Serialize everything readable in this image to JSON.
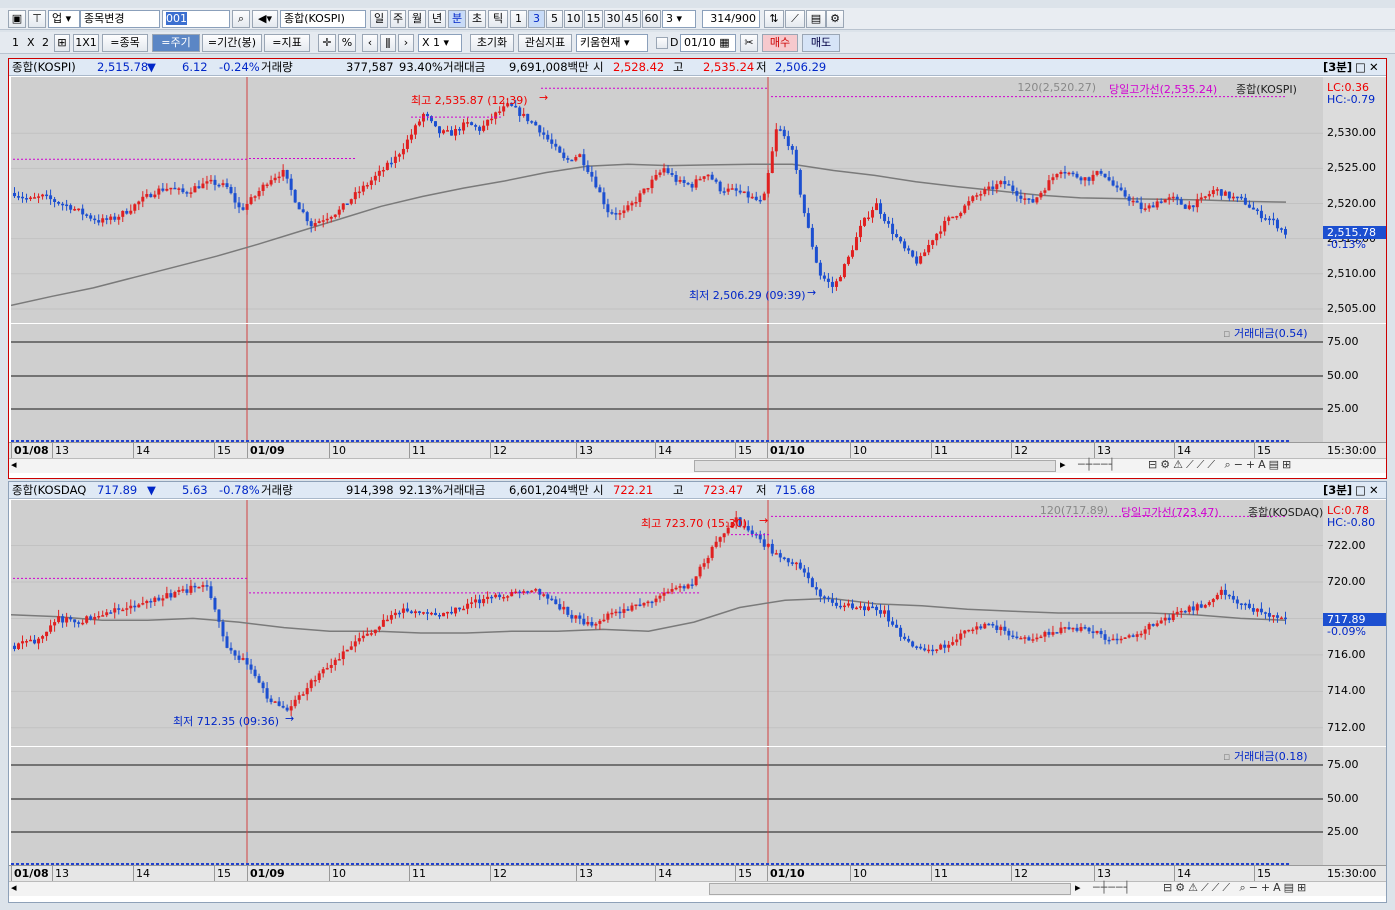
{
  "toolbar1": {
    "upjong": "업",
    "stock_change": "종목변경",
    "code": "001",
    "name": "종합(KOSPI)",
    "periods": [
      "일",
      "주",
      "월",
      "년",
      "분",
      "초",
      "틱"
    ],
    "selected_period": "분",
    "minutes": [
      "1",
      "3",
      "5",
      "10",
      "15",
      "30",
      "45",
      "60"
    ],
    "selected_minute": "3",
    "minute_select": "3",
    "count": "314",
    "count_total": "/900"
  },
  "toolbar2": {
    "layout": [
      "1",
      "X",
      "2"
    ],
    "grid_label": "1X1",
    "stock_btn": "=종목",
    "period_btn": "=주기",
    "range_btn": "=기간(봉)",
    "indicator_btn": "=지표",
    "pct": "%",
    "zoom": "X 1",
    "reset": "초기화",
    "interest": "관심지표",
    "kiwoom": "키움현재",
    "d_label": "D",
    "date": "01/10",
    "buy": "매수",
    "sell": "매도"
  },
  "pane1": {
    "name": "종합(KOSPI)",
    "price": "2,515.78",
    "arrow": "▼",
    "change": "6.12",
    "rate": "-0.24%",
    "vol_label": "거래량",
    "volume": "377,587",
    "vol_pct": "93.40%",
    "amt_label": "거래대금",
    "amount": "9,691,008백만",
    "open_label": "시",
    "open": "2,528.42",
    "high_label": "고",
    "high": "2,535.24",
    "low_label": "저",
    "low": "2,506.29",
    "interval": "[3분]",
    "ma_label": "120(2,520.27)",
    "highline": "당일고가선(2,535.24)",
    "series_label": "종합(KOSPI)",
    "lc": "LC:0.36",
    "hc": "HC:-0.79",
    "hi_ann": "최고 2,535.87 (12:39)",
    "lo_ann": "최저 2,506.29 (09:39)",
    "price_tag": "2,515.78",
    "pct_tag": "-0.13%",
    "y_ticks": [
      "2,530.00",
      "2,525.00",
      "2,520.00",
      "2,515.00",
      "2,510.00",
      "2,505.00"
    ],
    "sub_label": "거래대금(0.54)",
    "sub_ticks": [
      "75.00",
      "50.00",
      "25.00"
    ],
    "x_labels": [
      "01/08",
      "13",
      "14",
      "15",
      "01/09",
      "10",
      "11",
      "12",
      "13",
      "14",
      "15",
      "01/10",
      "10",
      "11",
      "12",
      "13",
      "14",
      "15"
    ],
    "time": "15:30:00"
  },
  "pane2": {
    "name": "종합(KOSDAQ",
    "price": "717.89",
    "arrow": "▼",
    "change": "5.63",
    "rate": "-0.78%",
    "vol_label": "거래량",
    "volume": "914,398",
    "vol_pct": "92.13%",
    "amt_label": "거래대금",
    "amount": "6,601,204백만",
    "open_label": "시",
    "open": "722.21",
    "high_label": "고",
    "high": "723.47",
    "low_label": "저",
    "low": "715.68",
    "interval": "[3분]",
    "ma_label": "120(717.89)",
    "highline": "당일고가선(723.47)",
    "series_label": "종합(KOSDAQ)",
    "lc": "LC:0.78",
    "hc": "HC:-0.80",
    "hi_ann": "최고 723.70 (15:30)",
    "lo_ann": "최저 712.35 (09:36)",
    "price_tag": "717.89",
    "pct_tag": "-0.09%",
    "y_ticks": [
      "722.00",
      "720.00",
      "718.00",
      "716.00",
      "714.00",
      "712.00"
    ],
    "sub_label": "거래대금(0.18)",
    "sub_ticks": [
      "75.00",
      "50.00",
      "25.00"
    ],
    "x_labels": [
      "01/08",
      "13",
      "14",
      "15",
      "01/09",
      "10",
      "11",
      "12",
      "13",
      "14",
      "15",
      "01/10",
      "10",
      "11",
      "12",
      "13",
      "14",
      "15"
    ],
    "time": "15:30:00"
  },
  "chart_data": [
    {
      "type": "candlestick",
      "title": "종합(KOSPI) 3분",
      "ylim": [
        2503,
        2538
      ],
      "ma_period": 120,
      "x_labels": [
        "01/08",
        "13",
        "14",
        "15",
        "01/09",
        "10",
        "11",
        "12",
        "13",
        "14",
        "15",
        "01/10",
        "10",
        "11",
        "12",
        "13",
        "14",
        "15"
      ],
      "close_path": [
        2521.5,
        2520.5,
        2521,
        2520.2,
        2519.5,
        2518.4,
        2517.5,
        2517.8,
        2519,
        2520.5,
        2521.8,
        2522.3,
        2521.5,
        2522.5,
        2523,
        2522.4,
        2519,
        2521,
        2523.4,
        2524.5,
        2520,
        2517,
        2518,
        2519,
        2521,
        2522.8,
        2524.6,
        2526.5,
        2529.5,
        2532.8,
        2530.1,
        2530,
        2531.4,
        2530.5,
        2532.6,
        2534,
        2532.5,
        2531,
        2528.5,
        2526,
        2527,
        2523.5,
        2519,
        2518.4,
        2520.5,
        2522.8,
        2525,
        2523,
        2522.6,
        2524.5,
        2522,
        2521.8,
        2521,
        2520,
        2531,
        2528,
        2518,
        2510,
        2508,
        2512,
        2517,
        2520,
        2516.5,
        2513.5,
        2511.5,
        2515,
        2517.5,
        2519,
        2521,
        2522,
        2523,
        2521.5,
        2520,
        2522.4,
        2525,
        2524,
        2523.5,
        2524.6,
        2522,
        2520.6,
        2519,
        2520.4,
        2520.7,
        2519.5,
        2520.4,
        2522,
        2521,
        2520.4,
        2518.6,
        2517.7,
        2515.8
      ],
      "ma_path": [
        2505.5,
        2506.8,
        2508,
        2509.5,
        2511,
        2512.5,
        2514.2,
        2516,
        2517.8,
        2519.6,
        2521,
        2522.2,
        2523.2,
        2524.4,
        2525.3,
        2525.6,
        2525.4,
        2525.5,
        2525.6,
        2525.6,
        2524.7,
        2524,
        2523.1,
        2522.4,
        2521.8,
        2521.2,
        2520.8,
        2520.7,
        2520.6,
        2520.5,
        2520.3,
        2520.2
      ]
    },
    {
      "type": "candlestick",
      "title": "종합(KOSDAQ) 3분",
      "ylim": [
        711,
        724.5
      ],
      "ma_period": 120,
      "x_labels": [
        "01/08",
        "13",
        "14",
        "15",
        "01/09",
        "10",
        "11",
        "12",
        "13",
        "14",
        "15",
        "01/10",
        "10",
        "11",
        "12",
        "13",
        "14",
        "15"
      ],
      "close_path": [
        716.5,
        716.8,
        718,
        717.8,
        718.3,
        718.5,
        718.7,
        719.2,
        719.5,
        720,
        716.5,
        715.5,
        713.5,
        713,
        714.5,
        715.5,
        716.5,
        717.5,
        718.3,
        718.5,
        718.2,
        718.5,
        719,
        719.3,
        719.6,
        719.4,
        718.4,
        717.6,
        718.2,
        718.6,
        719,
        719.5,
        720,
        722,
        723.5,
        722.5,
        721.5,
        721,
        719.2,
        718.7,
        718.6,
        718.4,
        716.8,
        716.2,
        716.5,
        717.3,
        717.7,
        717.2,
        716.8,
        717.3,
        717.5,
        717.2,
        716.7,
        717.2,
        717.8,
        718.3,
        718.7,
        719.5,
        718.8,
        718.2,
        717.9
      ],
      "ma_path": [
        718.2,
        718.1,
        717.9,
        717.9,
        718,
        717.8,
        717.5,
        717.3,
        717.3,
        717.2,
        717.2,
        717.3,
        717.3,
        717.4,
        717.3,
        717.8,
        718.6,
        719,
        719.1,
        718.8,
        718.7,
        718.5,
        718.4,
        718.3,
        718.3,
        718.3,
        718.2,
        718,
        717.9
      ]
    }
  ]
}
